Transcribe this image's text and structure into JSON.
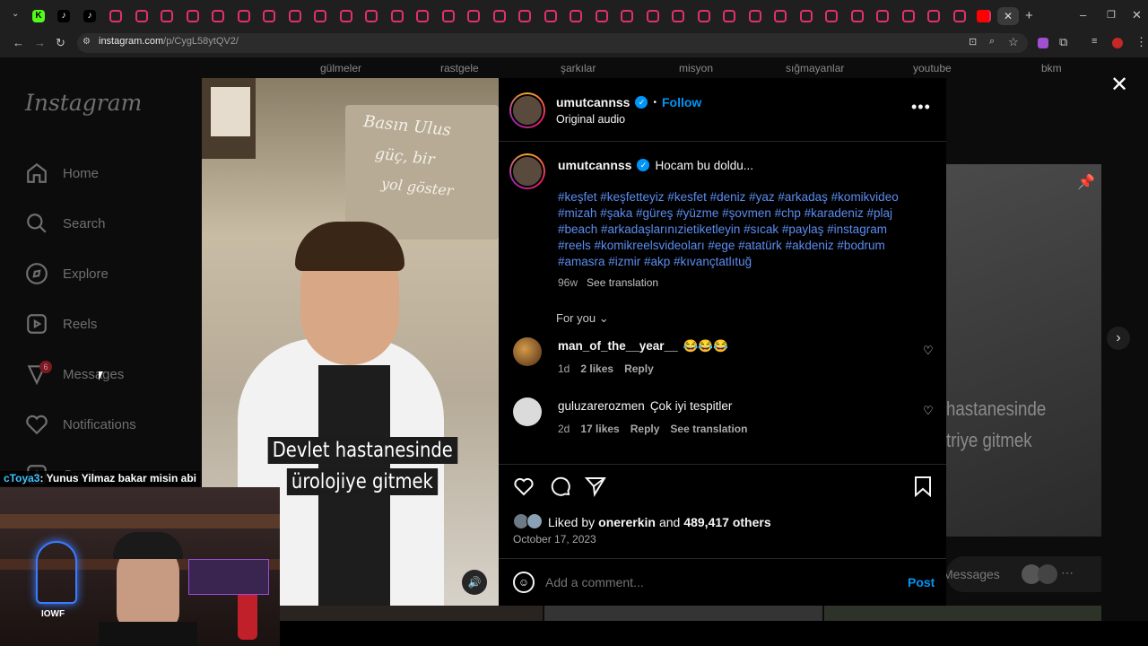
{
  "browser": {
    "url_host": "instagram.com",
    "url_path": "/p/CygL58ytQV2/",
    "tabs_add_label": "+",
    "bookmarks": [
      "gülmeler",
      "rastgele",
      "şarkılar",
      "misyon",
      "sığmayanlar",
      "youtube",
      "bkm"
    ]
  },
  "sidebar": {
    "logo": "Instagram",
    "items": [
      {
        "label": "Home",
        "icon": "home-icon"
      },
      {
        "label": "Search",
        "icon": "search-icon"
      },
      {
        "label": "Explore",
        "icon": "compass-icon"
      },
      {
        "label": "Reels",
        "icon": "reels-icon"
      },
      {
        "label": "Messages",
        "icon": "messenger-icon"
      },
      {
        "label": "Notifications",
        "icon": "heart-icon"
      },
      {
        "label": "Create",
        "icon": "plus-icon"
      }
    ],
    "messages_badge": "6"
  },
  "post": {
    "username": "umutcannss",
    "follow_label": "Follow",
    "bullet": "•",
    "audio": "Original audio",
    "caption_text": "Hocam bu doldu...",
    "hashtag_lines": [
      "#keşfet #keşfetteyiz #kesfet #deniz #yaz #arkadaş #komikvideo",
      "#mizah #şaka #güreş #yüzme #şovmen #chp #karadeniz #plaj",
      "#beach #arkadaşlarınızietiketleyin #sıcak #paylaş #instagram",
      "#reels #komikreelsvideoları #ege #atatürk #akdeniz #bodrum",
      "#amasra #izmir #akp #kıvançtatlıtuğ"
    ],
    "caption_age": "96w",
    "see_translation": "See translation",
    "for_you": "For you",
    "comments": [
      {
        "user": "man_of_the__year__",
        "text": "😂😂😂",
        "age": "1d",
        "likes": "2 likes",
        "reply": "Reply",
        "translate": ""
      },
      {
        "user": "guluzarerozmen",
        "text": "Çok iyi tespitler",
        "age": "2d",
        "likes": "17 likes",
        "reply": "Reply",
        "translate": "See translation"
      }
    ],
    "liked_by_prefix": "Liked by",
    "liked_by_user": "onererkin",
    "liked_by_and": "and",
    "liked_by_others": "489,417 others",
    "date": "October 17, 2023",
    "comment_placeholder": "Add a comment...",
    "post_button": "Post",
    "subtitle_line1": "Devlet hastanesinde",
    "subtitle_line2": "ürolojiye gitmek",
    "wall_text1": "Basın Ulus",
    "wall_text2": "güç, bir",
    "wall_text3": "yol göster"
  },
  "background_post": {
    "line1": "hastanesinde",
    "line2": "triye gitmek",
    "messages_label": "Messages"
  },
  "stream": {
    "chat_user": "cToya3",
    "chat_text": ": Yunus Yilmaz bakar misin abi",
    "logo_text": "IOWF"
  },
  "colors": {
    "accent": "#0095f6",
    "hashtag": "#5b8df0",
    "background": "#000000"
  }
}
